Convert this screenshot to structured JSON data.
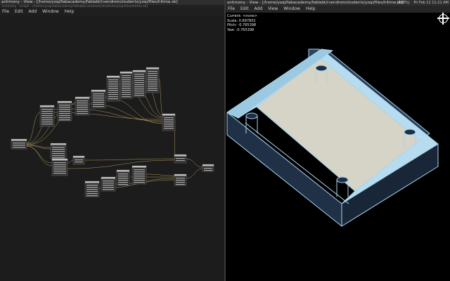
{
  "left": {
    "title": "antimony - View - [/home/yoqi/fabacademy/fablabt/rvendrom/students/yoqi/files/hitime.sb]",
    "graph_title": "antimony - Graph - [/home/yoqi/fabacademy/fablabt/rvendrom/students/yoqi/files/hitime.sb]",
    "menu": [
      "File",
      "Edit",
      "Add",
      "Window",
      "Help"
    ]
  },
  "right": {
    "title": "antimony - View - [/home/yoqi/fabacademy/fablabt/rvendrom/students/yoqi/files/hitime.sb]",
    "menu": [
      "File",
      "Edit",
      "Add",
      "View",
      "Window",
      "Help"
    ],
    "tray": {
      "battery": "(100%)",
      "clock": "Fri Feb 12 11:21 AM"
    },
    "info": {
      "current": "Current: <none>",
      "scale": "Scale: 0.697802",
      "pitch": "Pitch: -0.765398",
      "yaw": "Yaw: -0.765398"
    },
    "icons": [
      "move-icon"
    ]
  },
  "colors": {
    "graph_bg": "#1c1c1c",
    "node_bg": "#2f2f2f",
    "wire": "#b59a5a",
    "model_edge": "#a9d6ee",
    "model_wall": "#1f3047",
    "model_floor": "#d6d3c7"
  }
}
